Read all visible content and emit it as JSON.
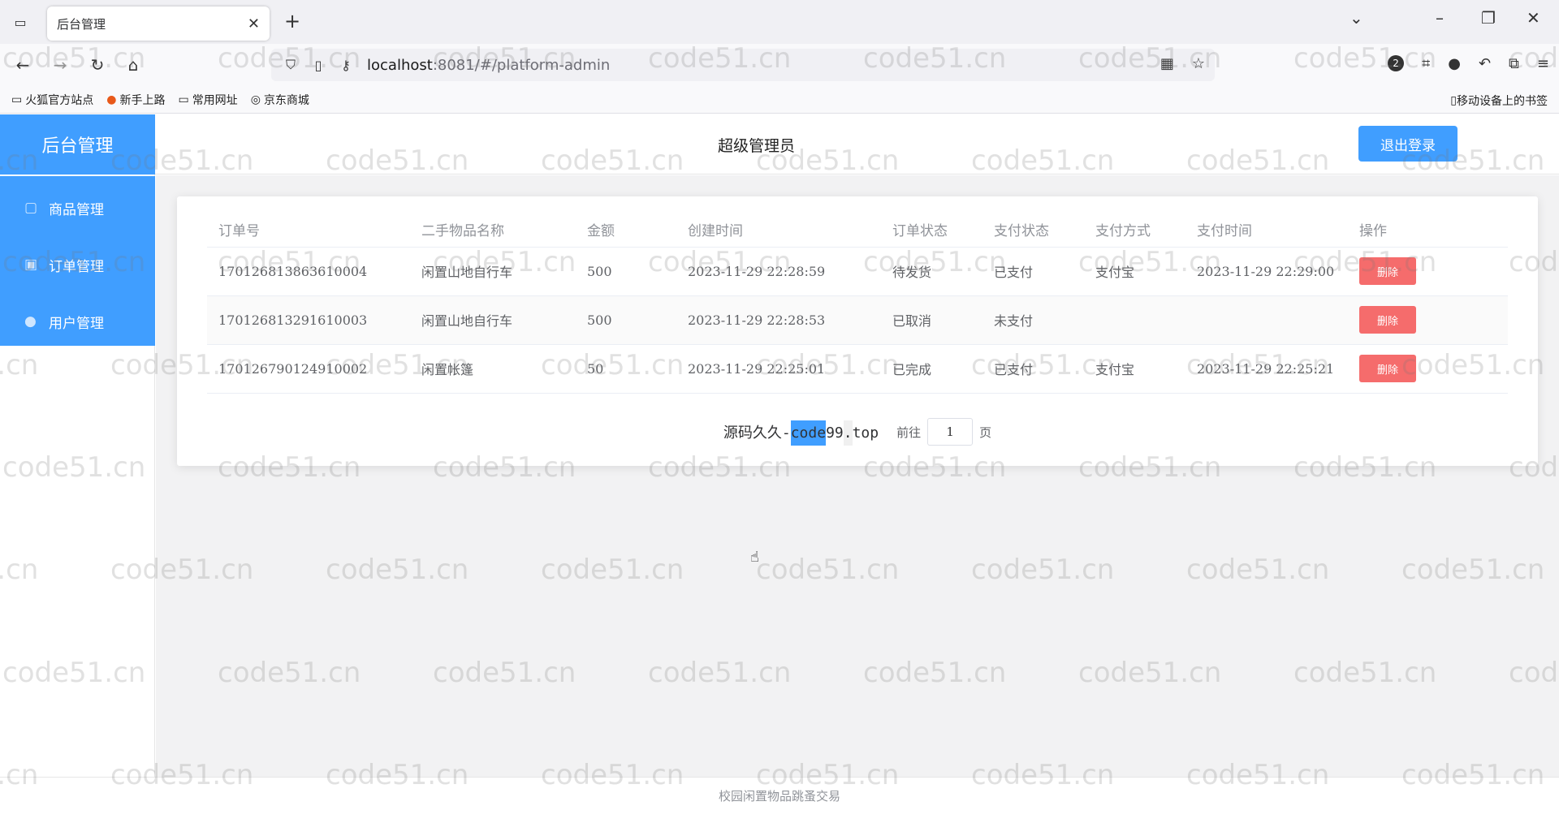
{
  "browser": {
    "tab_title": "后台管理",
    "url_host": "localhost",
    "url_rest": ":8081/#/platform-admin",
    "notification_count": "2",
    "bookmarks": [
      "火狐官方站点",
      "新手上路",
      "常用网址",
      "京东商城"
    ],
    "mobile_bookmarks": "移动设备上的书签"
  },
  "app": {
    "brand": "后台管理",
    "role": "超级管理员",
    "logout_label": "退出登录",
    "menu": [
      {
        "label": "商品管理",
        "icon": "bag-icon"
      },
      {
        "label": "订单管理",
        "icon": "shopping-bag-icon"
      },
      {
        "label": "用户管理",
        "icon": "user-icon"
      }
    ]
  },
  "table": {
    "headers": [
      "订单号",
      "二手物品名称",
      "金额",
      "创建时间",
      "订单状态",
      "支付状态",
      "支付方式",
      "支付时间",
      "操作"
    ],
    "rows": [
      {
        "order_no": "170126813863610004",
        "item": "闲置山地自行车",
        "amount": "500",
        "created": "2023-11-29 22:28:59",
        "order_status": "待发货",
        "pay_status": "已支付",
        "pay_method": "支付宝",
        "pay_time": "2023-11-29 22:29:00",
        "action": "删除"
      },
      {
        "order_no": "170126813291610003",
        "item": "闲置山地自行车",
        "amount": "500",
        "created": "2023-11-29 22:28:53",
        "order_status": "已取消",
        "pay_status": "未支付",
        "pay_method": "",
        "pay_time": "",
        "action": "删除"
      },
      {
        "order_no": "170126790124910002",
        "item": "闲置帐篷",
        "amount": "50",
        "created": "2023-11-29 22:25:01",
        "order_status": "已完成",
        "pay_status": "已支付",
        "pay_method": "支付宝",
        "pay_time": "2023-11-29 22:25:21",
        "action": "删除"
      }
    ]
  },
  "pager": {
    "source_prefix": "源码久久-",
    "source_hl": "code",
    "source_mid": "99",
    "source_gray": ".",
    "source_suffix": "top",
    "goto_label": "前往",
    "page_value": "1",
    "page_suffix": "页"
  },
  "footer": "校园闲置物品跳蚤交易",
  "watermark": "code51.cn"
}
